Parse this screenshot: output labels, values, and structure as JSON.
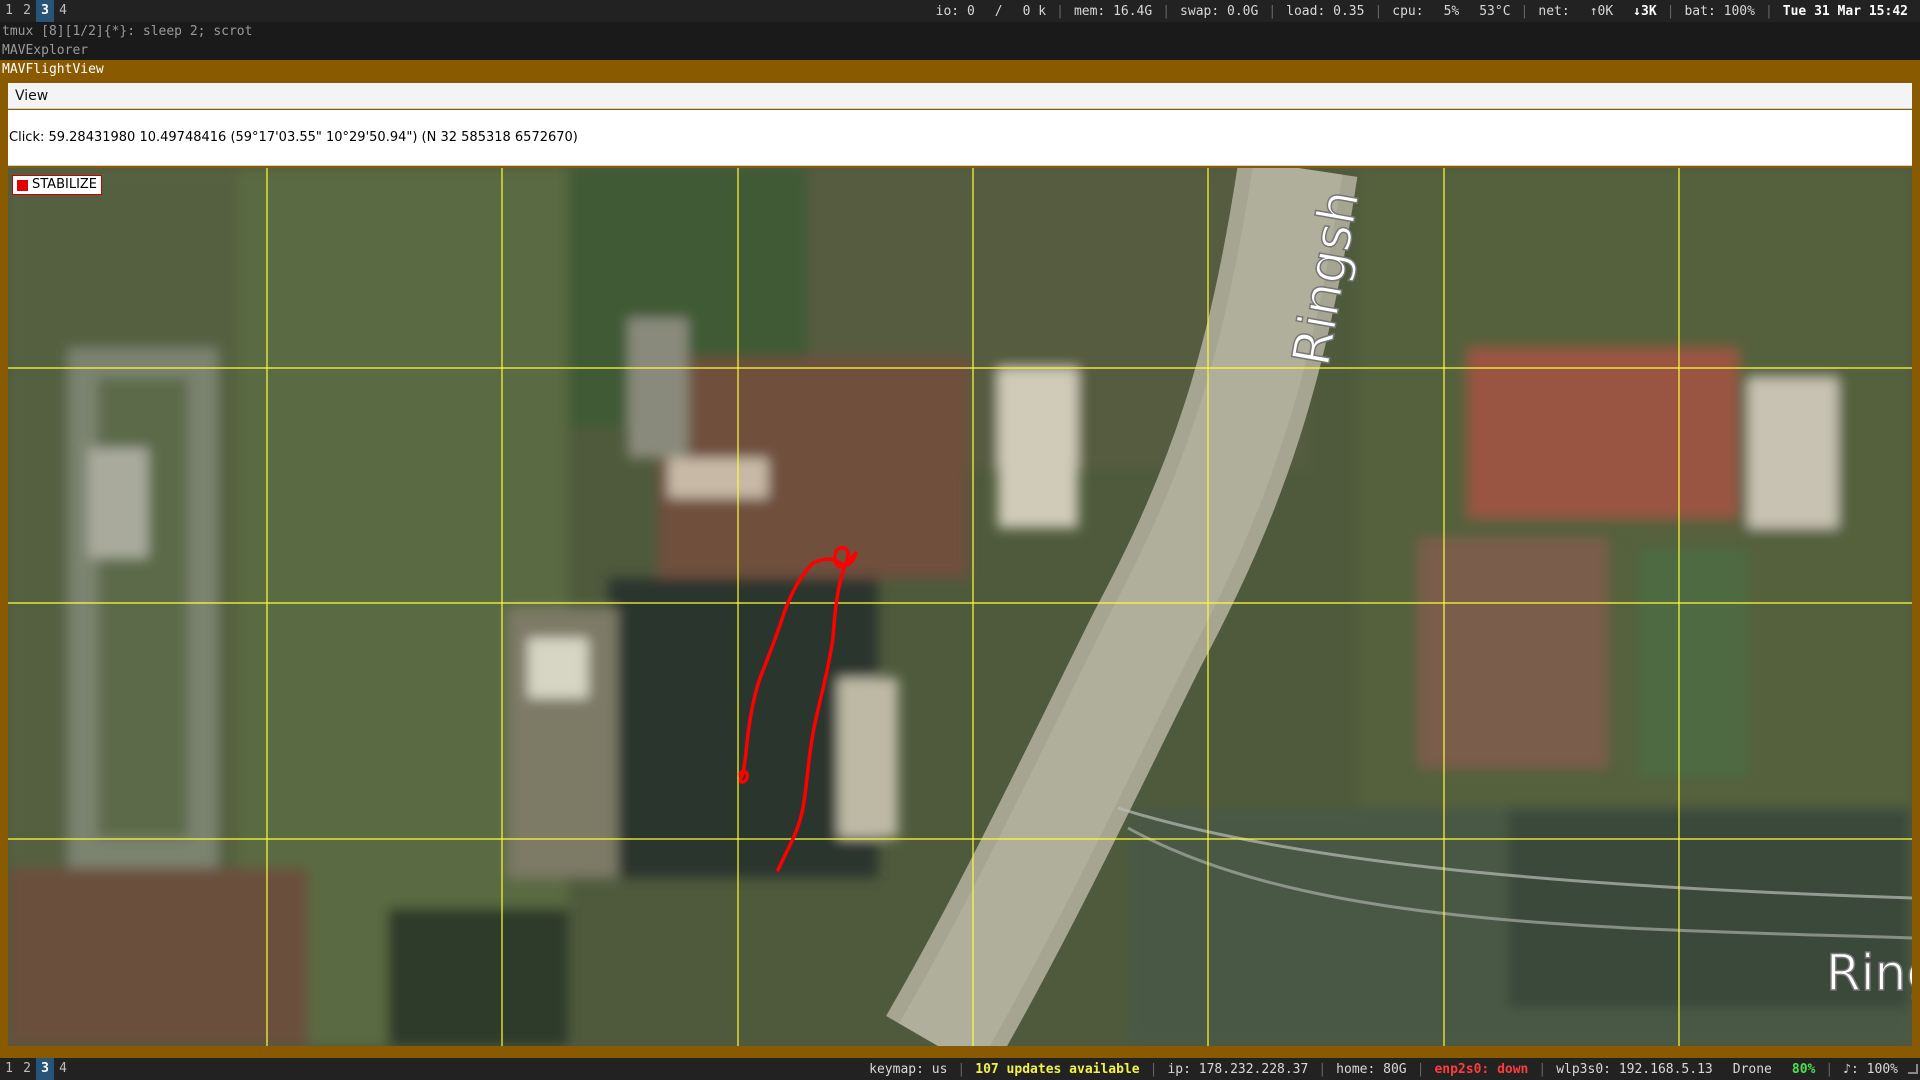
{
  "top_bar": {
    "workspaces": [
      "1",
      "2",
      "3",
      "4"
    ],
    "active_workspace": "3",
    "io": "io: 0",
    "disk": "/",
    "disk_free": "0 k",
    "mem": "mem: 16.4G",
    "swap": "swap: 0.0G",
    "load": "load: 0.35",
    "cpu_label": "cpu:",
    "cpu": "5%",
    "temp": "53°C",
    "net_label": "net:",
    "net_up": "↑0K",
    "net_down": "↓3K",
    "bat": "bat: 100%",
    "clock": "Tue 31 Mar 15:42"
  },
  "tmux_title": "tmux [8][1/2]{*}:  sleep 2; scrot",
  "explorer_title": "MAVExplorer",
  "flightview_title": "MAVFlightView",
  "menu": {
    "view": "View"
  },
  "info": {
    "click": "Click: 59.28431980 10.49748416 (59°17'03.55\" 10°29'50.94\") (N 32 585318 6572670)"
  },
  "map": {
    "mode": "STABILIZE",
    "mode_color": "#e00000",
    "track_color": "#ff0000",
    "grid_color": "#ffff33",
    "road_label_top": "Ringsh",
    "road_label_bottom": "Ring"
  },
  "bottom_bar": {
    "workspaces": [
      "1",
      "2",
      "3",
      "4"
    ],
    "active_workspace": "3",
    "keymap": "keymap: us",
    "updates": "107 updates available",
    "ip": "ip: 178.232.228.37",
    "home": "home: 80G",
    "enp": "enp2s0: down",
    "wlp": "wlp3s0: 192.168.5.13",
    "wifi_name": "Drone",
    "wifi_pct": "80%",
    "volume": "♪: 100%"
  }
}
